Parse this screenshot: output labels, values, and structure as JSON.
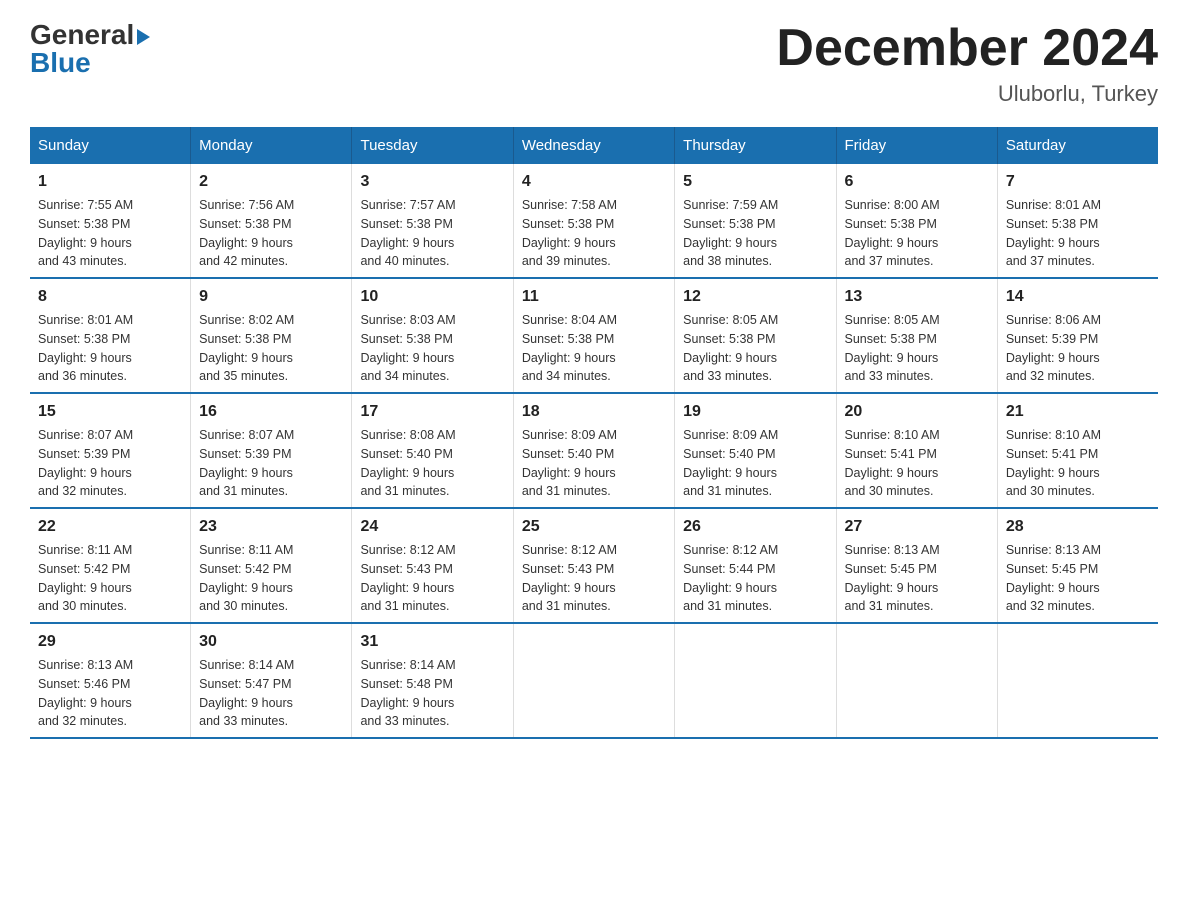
{
  "header": {
    "logo_general": "General",
    "logo_blue": "Blue",
    "title": "December 2024",
    "subtitle": "Uluborlu, Turkey"
  },
  "days_of_week": [
    "Sunday",
    "Monday",
    "Tuesday",
    "Wednesday",
    "Thursday",
    "Friday",
    "Saturday"
  ],
  "weeks": [
    [
      {
        "day": "1",
        "sunrise": "7:55 AM",
        "sunset": "5:38 PM",
        "daylight": "9 hours and 43 minutes."
      },
      {
        "day": "2",
        "sunrise": "7:56 AM",
        "sunset": "5:38 PM",
        "daylight": "9 hours and 42 minutes."
      },
      {
        "day": "3",
        "sunrise": "7:57 AM",
        "sunset": "5:38 PM",
        "daylight": "9 hours and 40 minutes."
      },
      {
        "day": "4",
        "sunrise": "7:58 AM",
        "sunset": "5:38 PM",
        "daylight": "9 hours and 39 minutes."
      },
      {
        "day": "5",
        "sunrise": "7:59 AM",
        "sunset": "5:38 PM",
        "daylight": "9 hours and 38 minutes."
      },
      {
        "day": "6",
        "sunrise": "8:00 AM",
        "sunset": "5:38 PM",
        "daylight": "9 hours and 37 minutes."
      },
      {
        "day": "7",
        "sunrise": "8:01 AM",
        "sunset": "5:38 PM",
        "daylight": "9 hours and 37 minutes."
      }
    ],
    [
      {
        "day": "8",
        "sunrise": "8:01 AM",
        "sunset": "5:38 PM",
        "daylight": "9 hours and 36 minutes."
      },
      {
        "day": "9",
        "sunrise": "8:02 AM",
        "sunset": "5:38 PM",
        "daylight": "9 hours and 35 minutes."
      },
      {
        "day": "10",
        "sunrise": "8:03 AM",
        "sunset": "5:38 PM",
        "daylight": "9 hours and 34 minutes."
      },
      {
        "day": "11",
        "sunrise": "8:04 AM",
        "sunset": "5:38 PM",
        "daylight": "9 hours and 34 minutes."
      },
      {
        "day": "12",
        "sunrise": "8:05 AM",
        "sunset": "5:38 PM",
        "daylight": "9 hours and 33 minutes."
      },
      {
        "day": "13",
        "sunrise": "8:05 AM",
        "sunset": "5:38 PM",
        "daylight": "9 hours and 33 minutes."
      },
      {
        "day": "14",
        "sunrise": "8:06 AM",
        "sunset": "5:39 PM",
        "daylight": "9 hours and 32 minutes."
      }
    ],
    [
      {
        "day": "15",
        "sunrise": "8:07 AM",
        "sunset": "5:39 PM",
        "daylight": "9 hours and 32 minutes."
      },
      {
        "day": "16",
        "sunrise": "8:07 AM",
        "sunset": "5:39 PM",
        "daylight": "9 hours and 31 minutes."
      },
      {
        "day": "17",
        "sunrise": "8:08 AM",
        "sunset": "5:40 PM",
        "daylight": "9 hours and 31 minutes."
      },
      {
        "day": "18",
        "sunrise": "8:09 AM",
        "sunset": "5:40 PM",
        "daylight": "9 hours and 31 minutes."
      },
      {
        "day": "19",
        "sunrise": "8:09 AM",
        "sunset": "5:40 PM",
        "daylight": "9 hours and 31 minutes."
      },
      {
        "day": "20",
        "sunrise": "8:10 AM",
        "sunset": "5:41 PM",
        "daylight": "9 hours and 30 minutes."
      },
      {
        "day": "21",
        "sunrise": "8:10 AM",
        "sunset": "5:41 PM",
        "daylight": "9 hours and 30 minutes."
      }
    ],
    [
      {
        "day": "22",
        "sunrise": "8:11 AM",
        "sunset": "5:42 PM",
        "daylight": "9 hours and 30 minutes."
      },
      {
        "day": "23",
        "sunrise": "8:11 AM",
        "sunset": "5:42 PM",
        "daylight": "9 hours and 30 minutes."
      },
      {
        "day": "24",
        "sunrise": "8:12 AM",
        "sunset": "5:43 PM",
        "daylight": "9 hours and 31 minutes."
      },
      {
        "day": "25",
        "sunrise": "8:12 AM",
        "sunset": "5:43 PM",
        "daylight": "9 hours and 31 minutes."
      },
      {
        "day": "26",
        "sunrise": "8:12 AM",
        "sunset": "5:44 PM",
        "daylight": "9 hours and 31 minutes."
      },
      {
        "day": "27",
        "sunrise": "8:13 AM",
        "sunset": "5:45 PM",
        "daylight": "9 hours and 31 minutes."
      },
      {
        "day": "28",
        "sunrise": "8:13 AM",
        "sunset": "5:45 PM",
        "daylight": "9 hours and 32 minutes."
      }
    ],
    [
      {
        "day": "29",
        "sunrise": "8:13 AM",
        "sunset": "5:46 PM",
        "daylight": "9 hours and 32 minutes."
      },
      {
        "day": "30",
        "sunrise": "8:14 AM",
        "sunset": "5:47 PM",
        "daylight": "9 hours and 33 minutes."
      },
      {
        "day": "31",
        "sunrise": "8:14 AM",
        "sunset": "5:48 PM",
        "daylight": "9 hours and 33 minutes."
      },
      null,
      null,
      null,
      null
    ]
  ]
}
